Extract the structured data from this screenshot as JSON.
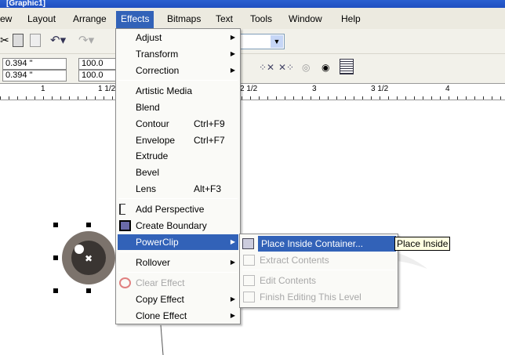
{
  "window": {
    "title": "[Graphic1]"
  },
  "menubar": [
    "ew",
    "Layout",
    "Arrange",
    "Effects",
    "Bitmaps",
    "Text",
    "Tools",
    "Window",
    "Help"
  ],
  "propbar": {
    "x": "0.394 \"",
    "y": "0.394 \"",
    "sx": "100.0",
    "sy": "100.0"
  },
  "ruler": [
    "1",
    "1 1/2",
    "2 1/2",
    "3",
    "3 1/2",
    "4"
  ],
  "effects_menu": {
    "items": [
      {
        "label": "Adjust",
        "sub": true
      },
      {
        "label": "Transform",
        "sub": true
      },
      {
        "label": "Correction",
        "sub": true
      },
      {
        "label": "Artistic Media"
      },
      {
        "label": "Blend"
      },
      {
        "label": "Contour",
        "shortcut": "Ctrl+F9"
      },
      {
        "label": "Envelope",
        "shortcut": "Ctrl+F7"
      },
      {
        "label": "Extrude"
      },
      {
        "label": "Bevel"
      },
      {
        "label": "Lens",
        "shortcut": "Alt+F3"
      },
      {
        "label": "Add Perspective"
      },
      {
        "label": "Create Boundary"
      },
      {
        "label": "PowerClip",
        "sub": true
      },
      {
        "label": "Rollover",
        "sub": true
      },
      {
        "label": "Clear Effect"
      },
      {
        "label": "Copy Effect",
        "sub": true
      },
      {
        "label": "Clone Effect",
        "sub": true
      }
    ]
  },
  "powerclip_menu": [
    "Place Inside Container...",
    "Extract Contents",
    "Edit Contents",
    "Finish Editing This Level"
  ],
  "tooltip": "Place Inside",
  "colors": {
    "highlight": "#3262b8",
    "menubar": "#eceae0"
  }
}
